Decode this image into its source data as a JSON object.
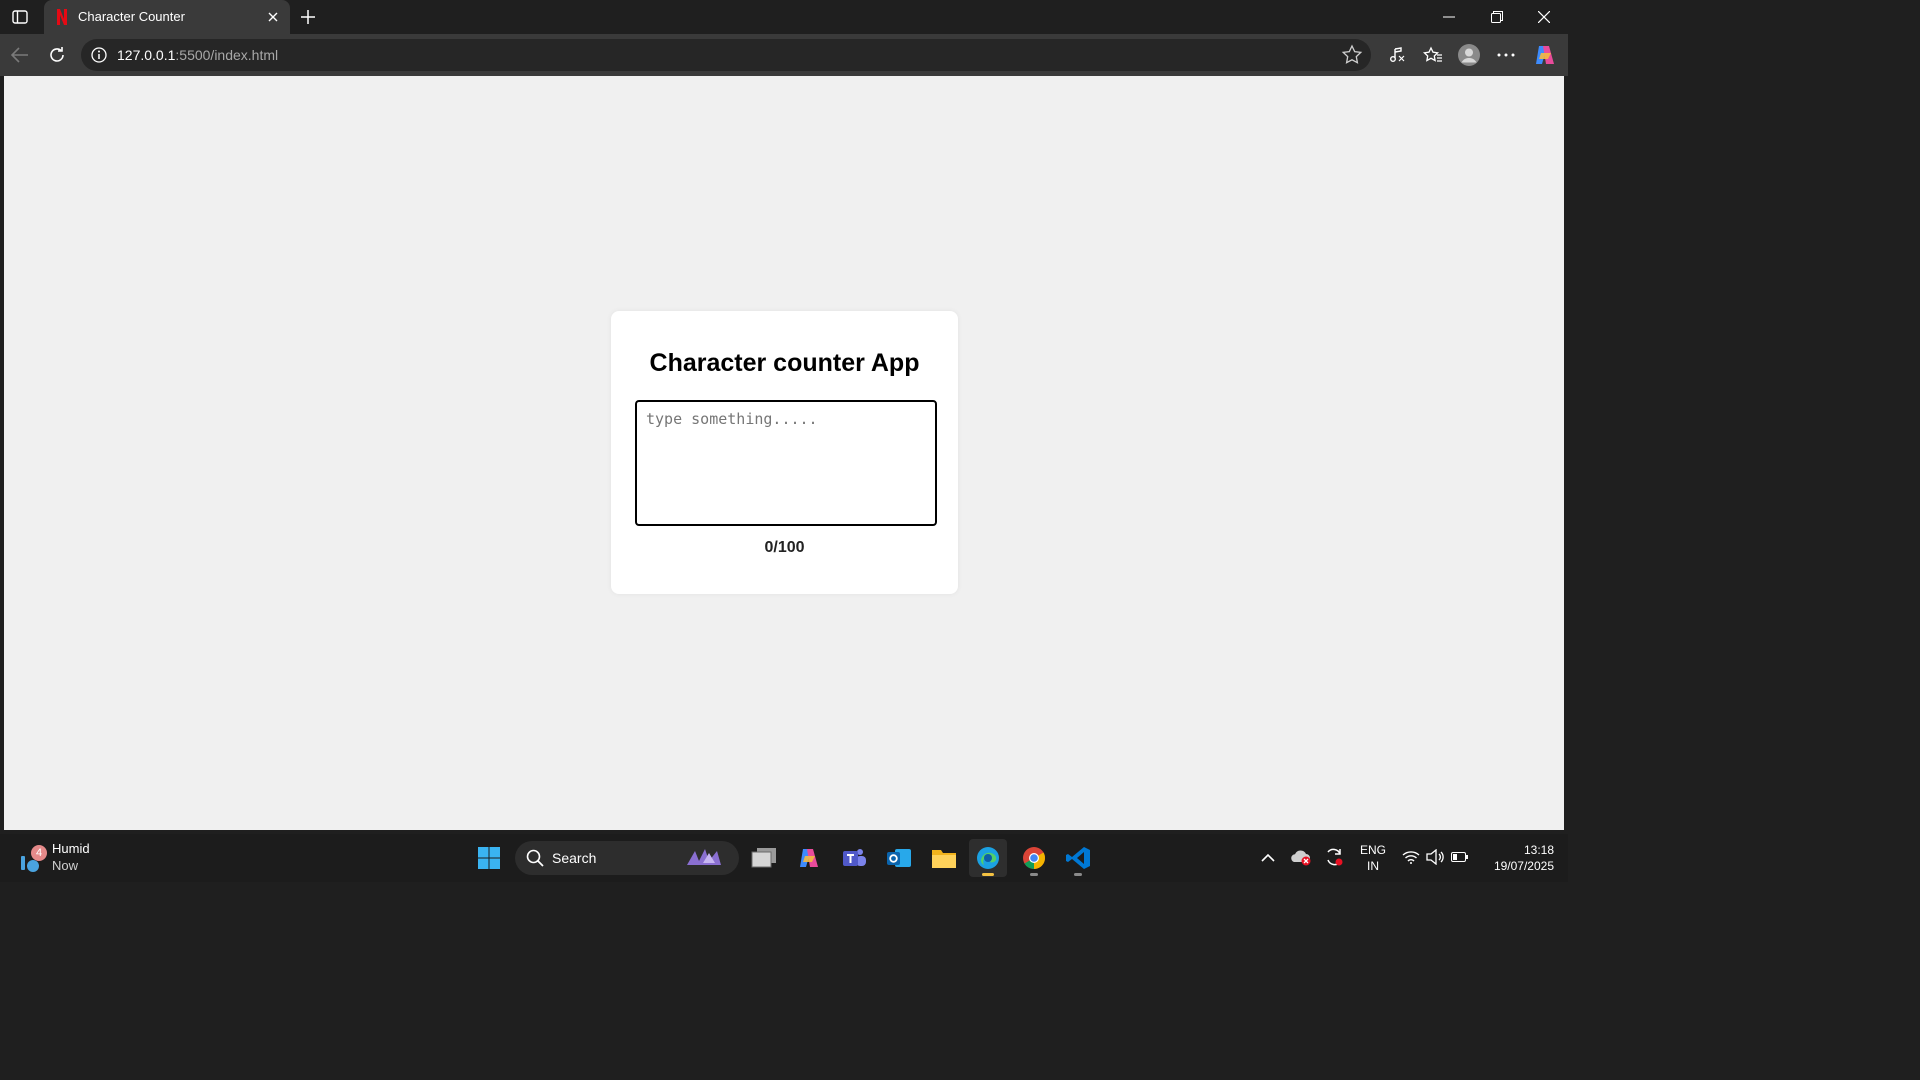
{
  "browser": {
    "tab_title": "Character Counter",
    "url_host": "127.0.0.1",
    "url_rest": ":5500/index.html"
  },
  "app": {
    "title": "Character counter App",
    "textarea_placeholder": "type something.....",
    "counter": "0/100"
  },
  "taskbar": {
    "weather_badge": "4",
    "weather_label": "Humid",
    "weather_time": "Now",
    "search_label": "Search",
    "lang_top": "ENG",
    "lang_bottom": "IN",
    "time": "13:18",
    "date": "19/07/2025"
  },
  "colors": {
    "accent_active": "#f5c242",
    "card_background": "#ffffff",
    "page_background": "#f0f0f0"
  }
}
